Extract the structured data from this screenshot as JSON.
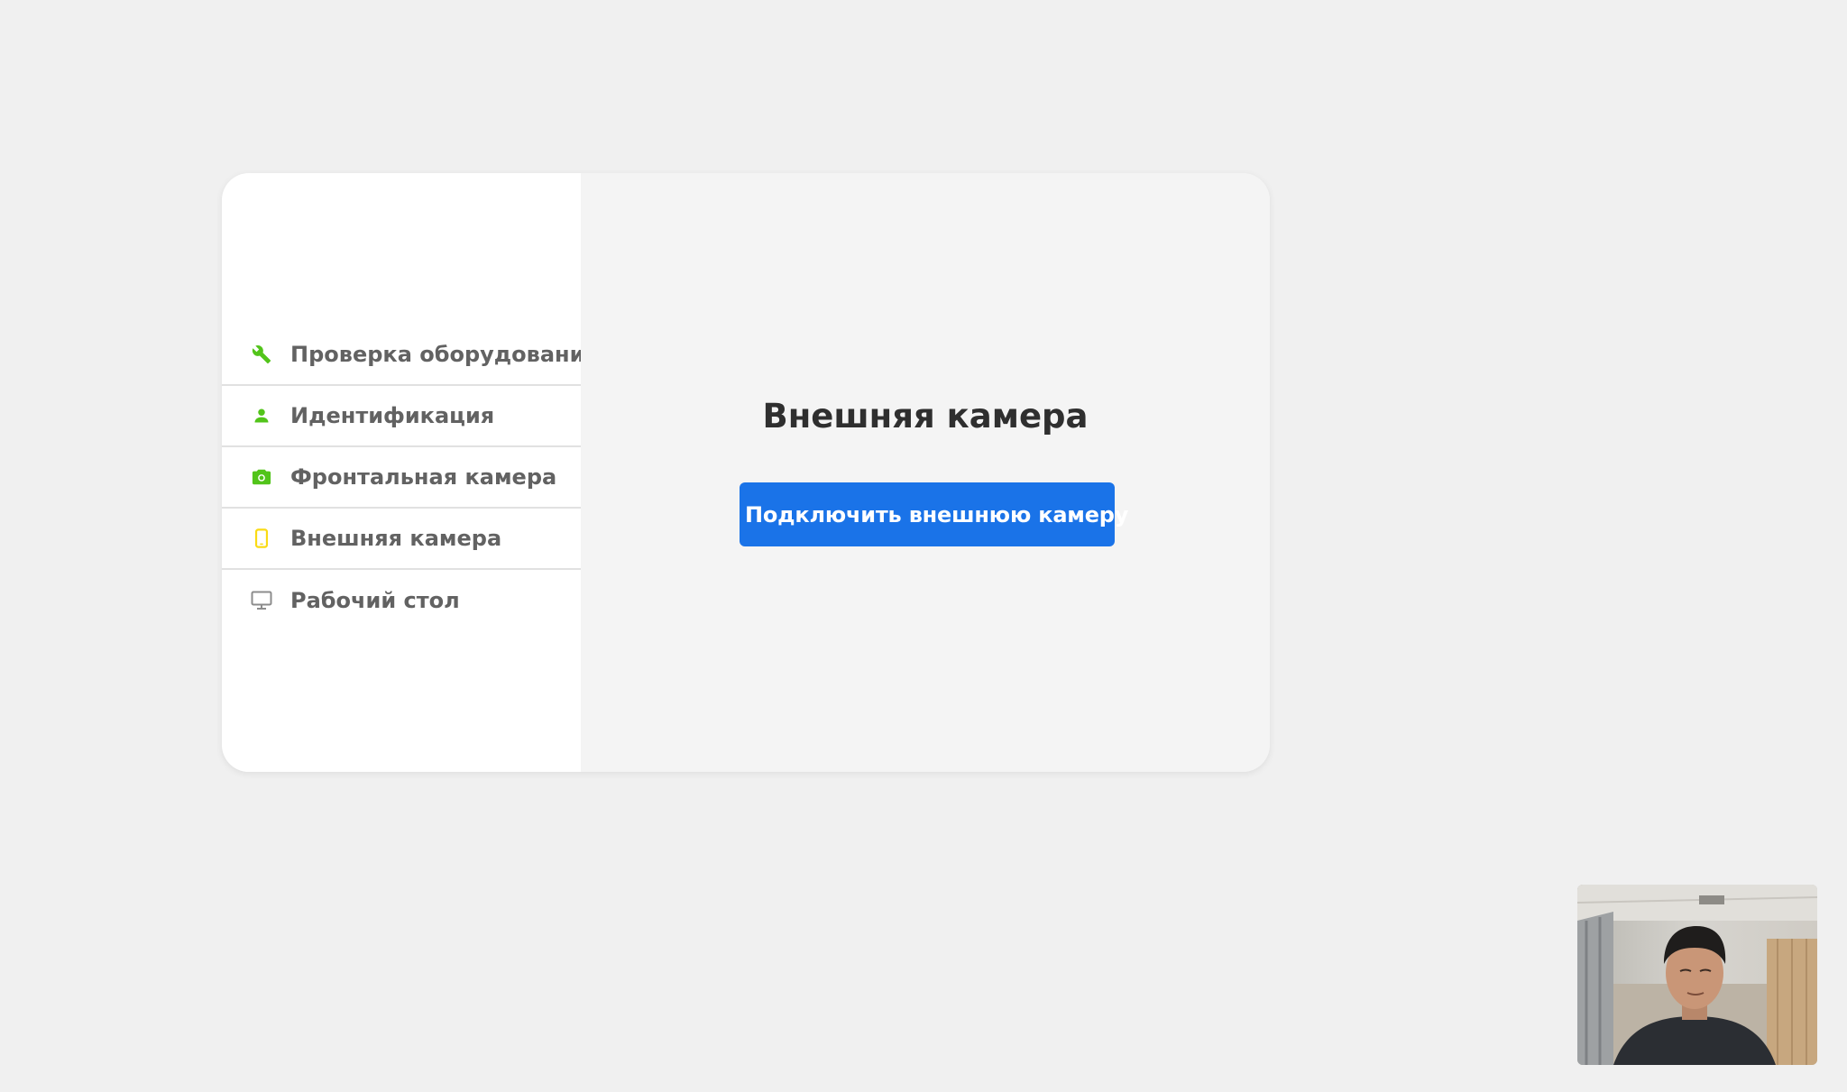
{
  "sidebar": {
    "items": [
      {
        "label": "Проверка оборудования",
        "icon": "wrench-icon",
        "icon_color": "#52c41a"
      },
      {
        "label": "Идентификация",
        "icon": "person-icon",
        "icon_color": "#52c41a"
      },
      {
        "label": "Фронтальная камера",
        "icon": "camera-icon",
        "icon_color": "#52c41a"
      },
      {
        "label": "Внешняя камера",
        "icon": "phone-icon",
        "icon_color": "#fadb14"
      },
      {
        "label": "Рабочий стол",
        "icon": "monitor-icon",
        "icon_color": "#8c8c8c"
      }
    ]
  },
  "main": {
    "title": "Внешняя камера",
    "connect_button_label": "Подключить внешнюю камеру"
  },
  "colors": {
    "accent": "#1a73e8",
    "done": "#52c41a",
    "current": "#fadb14",
    "pending": "#8c8c8c"
  },
  "webcam": {
    "icon": "webcam-preview"
  }
}
